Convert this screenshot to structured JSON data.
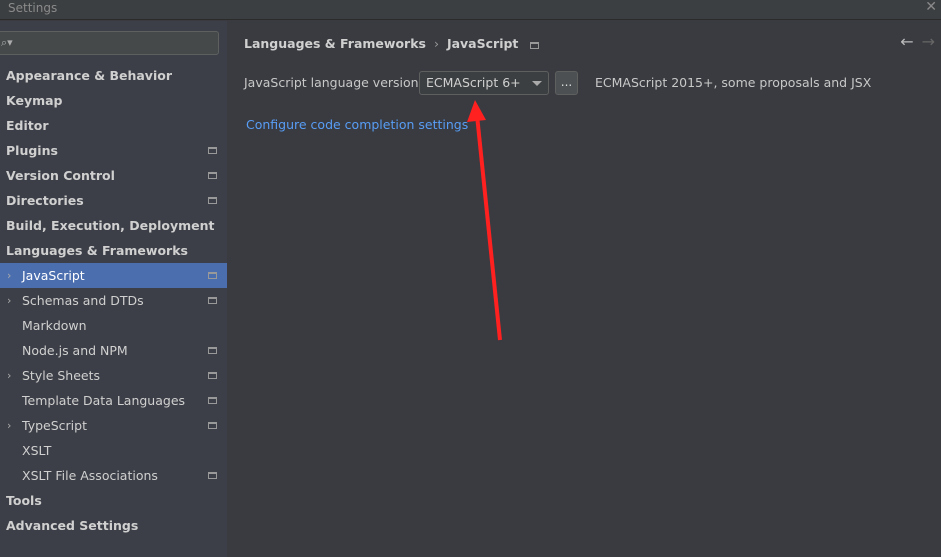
{
  "window": {
    "title": "Settings"
  },
  "search": {
    "placeholder": ""
  },
  "sidebar": {
    "items": [
      {
        "label": "Appearance & Behavior",
        "level": "top"
      },
      {
        "label": "Keymap",
        "level": "top"
      },
      {
        "label": "Editor",
        "level": "top"
      },
      {
        "label": "Plugins",
        "level": "top",
        "badge": true
      },
      {
        "label": "Version Control",
        "level": "top",
        "badge": true
      },
      {
        "label": "Directories",
        "level": "top",
        "badge": true
      },
      {
        "label": "Build, Execution, Deployment",
        "level": "top"
      },
      {
        "label": "Languages & Frameworks",
        "level": "top"
      },
      {
        "label": "JavaScript",
        "level": "sub",
        "expandable": true,
        "badge": true,
        "selected": true
      },
      {
        "label": "Schemas and DTDs",
        "level": "sub",
        "expandable": true,
        "badge": true
      },
      {
        "label": "Markdown",
        "level": "sub"
      },
      {
        "label": "Node.js and NPM",
        "level": "sub",
        "badge": true
      },
      {
        "label": "Style Sheets",
        "level": "sub",
        "expandable": true,
        "badge": true
      },
      {
        "label": "Template Data Languages",
        "level": "sub",
        "badge": true
      },
      {
        "label": "TypeScript",
        "level": "sub",
        "expandable": true,
        "badge": true
      },
      {
        "label": "XSLT",
        "level": "sub"
      },
      {
        "label": "XSLT File Associations",
        "level": "sub",
        "badge": true
      },
      {
        "label": "Tools",
        "level": "top"
      },
      {
        "label": "Advanced Settings",
        "level": "top"
      }
    ]
  },
  "breadcrumb": {
    "parent": "Languages & Frameworks",
    "current": "JavaScript",
    "separator": "›"
  },
  "nav": {
    "back": "←",
    "forward": "→"
  },
  "main": {
    "version_label": "JavaScript language version",
    "version_value": "ECMAScript 6+",
    "more_button": "...",
    "version_description": "ECMAScript 2015+, some proposals and JSX",
    "link": "Configure code completion settings"
  },
  "colors": {
    "selection": "#4b6eaf",
    "link": "#589df6",
    "annotation_arrow": "#ff2020"
  }
}
